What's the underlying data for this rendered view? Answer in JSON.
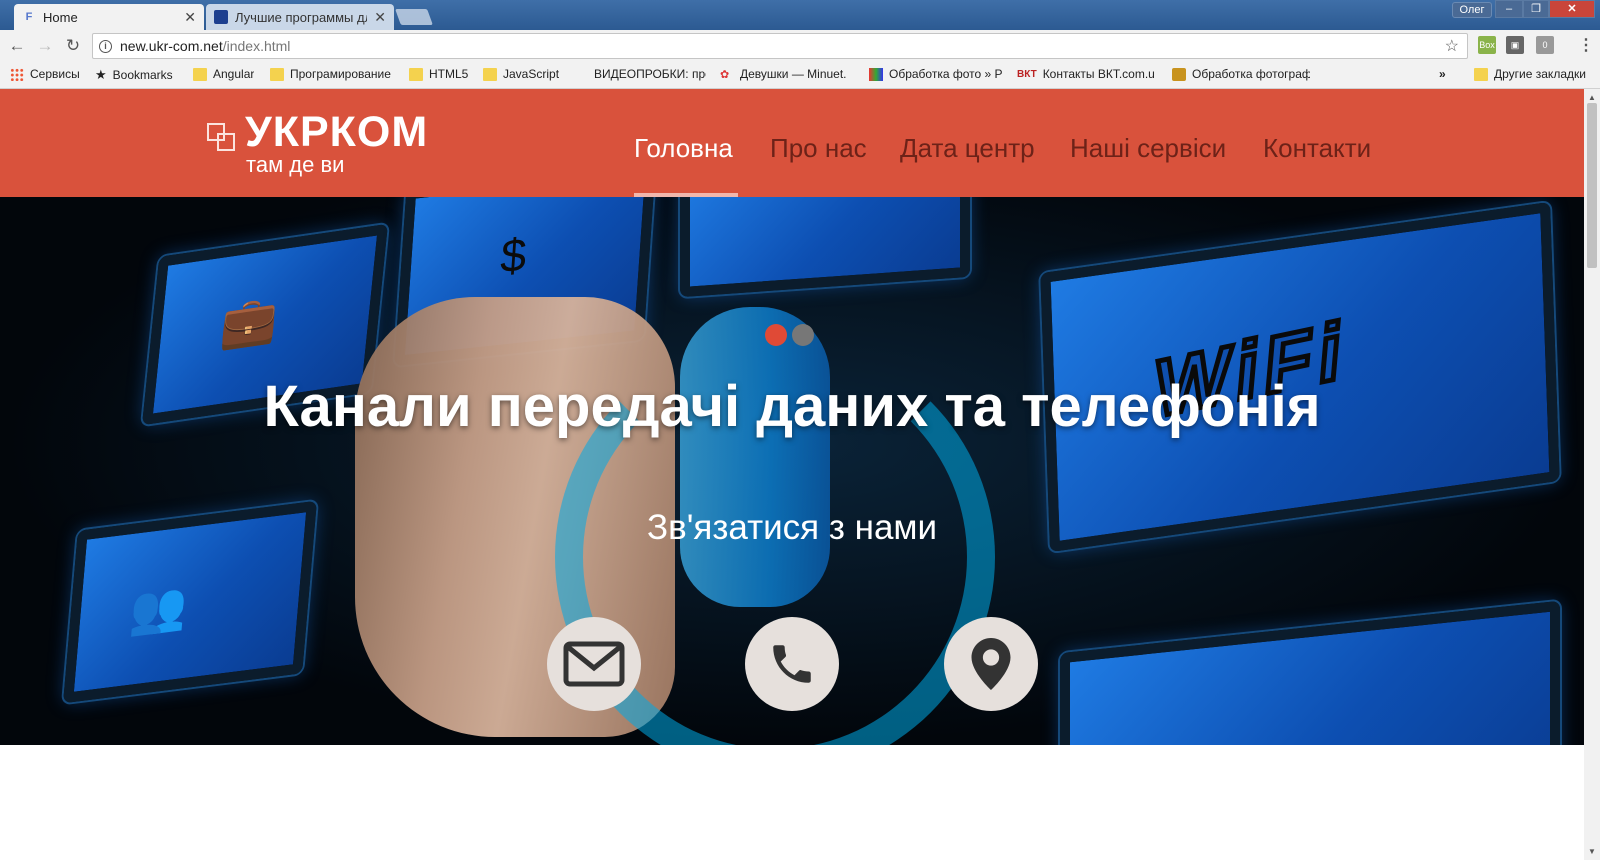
{
  "browser": {
    "tabs": [
      {
        "title": "Home",
        "icon": "page-favicon"
      },
      {
        "title": "Лучшие программы для",
        "icon": "monitor-favicon"
      }
    ],
    "user": "Олег",
    "url_host": "new.ukr-com.net",
    "url_path": "/index.html",
    "bookmarks": [
      "Сервисы",
      "Bookmarks",
      "Angular",
      "Програмирование",
      "HTML5",
      "JavaScript",
      "ВИДЕОПРОБКИ: про",
      "Девушки — Minuet.",
      "Обработка фото » Р",
      "Контакты ВКТ.com.u",
      "Обработка фотограф"
    ],
    "more_bookmarks": "»",
    "other_bookmarks": "Другие закладки",
    "extension_labels": [
      "Box",
      "0"
    ]
  },
  "site": {
    "brand": "УКРКОМ",
    "tagline": "там де ви",
    "nav": [
      "Головна",
      "Про нас",
      "Дата центр",
      "Наші сервіси",
      "Контакти"
    ],
    "hero_title": "Канали передачі даних та телефонія",
    "hero_subtitle": "Зв'язатися з нами",
    "monitor_text": "WiFi",
    "colors": {
      "header": "#d9523c",
      "active_dot": "#e04a36"
    }
  }
}
